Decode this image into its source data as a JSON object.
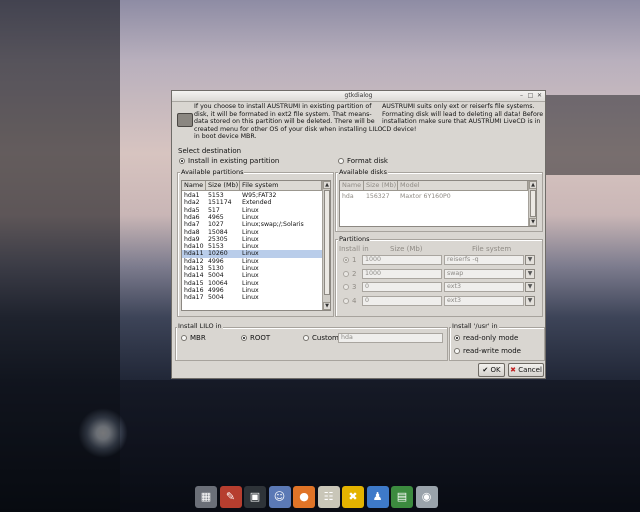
{
  "window": {
    "title": "gtkdialog",
    "controls": [
      "minimize-icon",
      "maximize-icon",
      "close-icon"
    ]
  },
  "info": {
    "left": "If you choose to install AUSTRUMI in existing partition of disk, it will be formated in ext2 file system. That means-data stored on this partition will be deleted. There will be created menu for other OS of your disk when installing LILO in boot device MBR.",
    "right": "AUSTRUMI suits only ext or reiserfs file systems. Formating disk will lead to deleting all data! Before installation make sure that AUSTRUMI LiveCD is in CD device!"
  },
  "destination": {
    "label": "Select destination",
    "option_existing": "Install in existing partition",
    "option_format": "Format disk",
    "selected": "existing"
  },
  "available_partitions": {
    "label": "Available partitions",
    "columns": [
      "Name",
      "Size (Mb)",
      "File system"
    ],
    "rows": [
      [
        "hda1",
        "5153",
        "W95;FAT32"
      ],
      [
        "hda2",
        "151174",
        "Extended"
      ],
      [
        "hda5",
        "517",
        "Linux"
      ],
      [
        "hda6",
        "4965",
        "Linux"
      ],
      [
        "hda7",
        "1027",
        "Linux;swap;/;Solaris"
      ],
      [
        "hda8",
        "15084",
        "Linux"
      ],
      [
        "hda9",
        "25305",
        "Linux"
      ],
      [
        "hda10",
        "5153",
        "Linux"
      ],
      [
        "hda11",
        "10260",
        "Linux"
      ],
      [
        "hda12",
        "4996",
        "Linux"
      ],
      [
        "hda13",
        "5130",
        "Linux"
      ],
      [
        "hda14",
        "5004",
        "Linux"
      ],
      [
        "hda15",
        "10064",
        "Linux"
      ],
      [
        "hda16",
        "4996",
        "Linux"
      ],
      [
        "hda17",
        "5004",
        "Linux"
      ]
    ],
    "selected_row": 8
  },
  "available_disks": {
    "label": "Available disks",
    "columns": [
      "Name",
      "Size (Mb)",
      "Model"
    ],
    "rows": [
      [
        "hda",
        "156327",
        "Maxtor 6Y160P0"
      ]
    ]
  },
  "partitions": {
    "label": "Partitions",
    "col_install": "Install in",
    "col_size": "Size (Mb)",
    "col_fs": "File system",
    "rows": [
      {
        "num": "1",
        "size": "1000",
        "fs": "reiserfs -q",
        "selected": true
      },
      {
        "num": "2",
        "size": "1000",
        "fs": "swap",
        "selected": false
      },
      {
        "num": "3",
        "size": "0",
        "fs": "ext3",
        "selected": false
      },
      {
        "num": "4",
        "size": "0",
        "fs": "ext3",
        "selected": false
      }
    ]
  },
  "lilo": {
    "label": "Install LILO in",
    "mbr": "MBR",
    "root": "ROOT",
    "custom": "Custom",
    "custom_value": "hda",
    "selected": "root"
  },
  "usr": {
    "label": "Install '/usr' in",
    "readonly": "read-only mode",
    "readwrite": "read-write mode",
    "selected": "readonly"
  },
  "buttons": {
    "ok": "OK",
    "cancel": "Cancel"
  },
  "taskbar": {
    "items": [
      "kpager-icon",
      "graphics-app-icon",
      "terminal-icon",
      "file-manager-icon",
      "firefox-icon",
      "network-icon",
      "tools-icon",
      "pidgin-icon",
      "document-icon",
      "installer-icon"
    ],
    "colors": [
      "#6b6f78",
      "#b63e2f",
      "#2e3338",
      "#5b79b5",
      "#e07427",
      "#c9c6b8",
      "#e4b300",
      "#3e7ac9",
      "#3c8b3f",
      "#9aa3ab"
    ]
  }
}
